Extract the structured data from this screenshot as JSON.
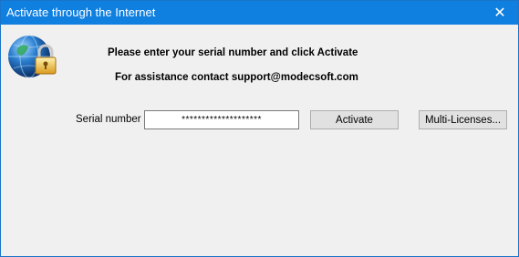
{
  "window": {
    "title": "Activate through the Internet",
    "close_glyph": "✕"
  },
  "message": {
    "line1": "Please enter your serial number and click Activate",
    "line2": "For assistance contact support@modecsoft.com"
  },
  "serial": {
    "label": "Serial number",
    "value": "********************"
  },
  "buttons": {
    "activate": "Activate",
    "multi_licenses": "Multi-Licenses..."
  },
  "icons": {
    "logo": "globe-lock-icon",
    "close": "close-icon"
  },
  "colors": {
    "titlebar": "#0f7fe0",
    "background": "#f0f0f0",
    "button": "#e1e1e1"
  }
}
